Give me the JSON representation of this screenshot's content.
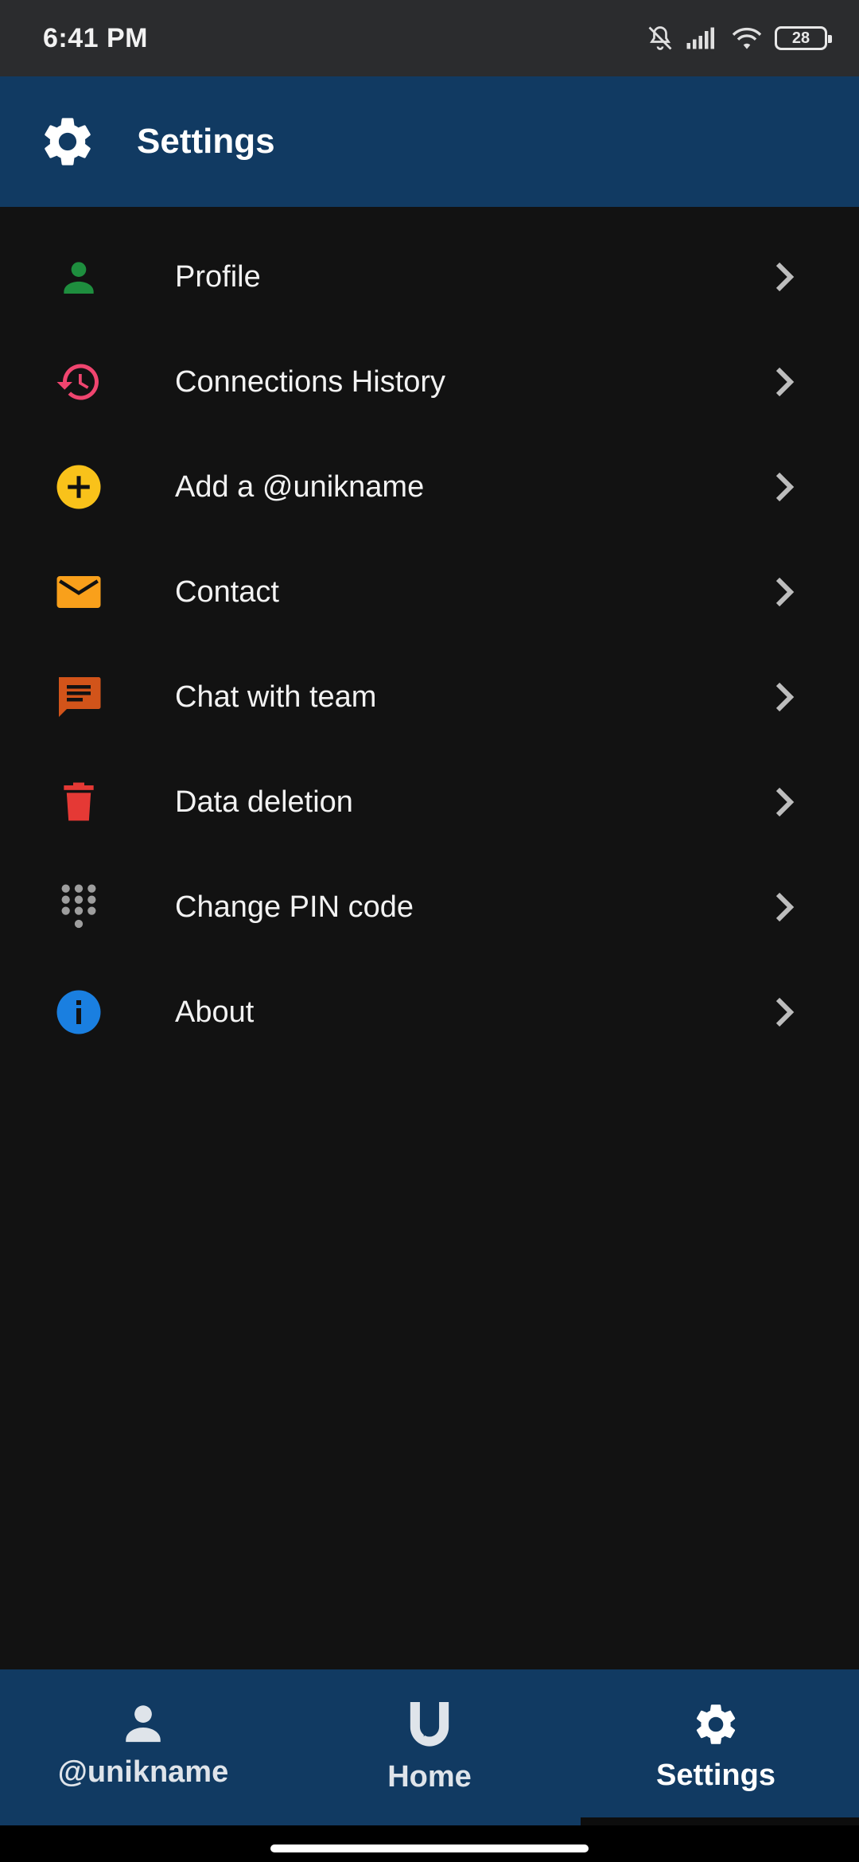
{
  "status_bar": {
    "time": "6:41 PM",
    "battery": "28"
  },
  "app_bar": {
    "title": "Settings",
    "icon": "gear-icon"
  },
  "menu": {
    "items": [
      {
        "label": "Profile",
        "icon": "person-icon",
        "color": "#1e8e3e"
      },
      {
        "label": "Connections History",
        "icon": "history-icon",
        "color": "#f0456f"
      },
      {
        "label": "Add a @unikname",
        "icon": "add-circle-icon",
        "color": "#f9c21a"
      },
      {
        "label": "Contact",
        "icon": "mail-icon",
        "color": "#f9a01b"
      },
      {
        "label": "Chat with team",
        "icon": "chat-icon",
        "color": "#d2541a"
      },
      {
        "label": "Data deletion",
        "icon": "trash-icon",
        "color": "#e53935"
      },
      {
        "label": "Change PIN code",
        "icon": "dialpad-icon",
        "color": "#9e9e9e"
      },
      {
        "label": "About",
        "icon": "info-icon",
        "color": "#1a7fe0"
      }
    ]
  },
  "bottom_nav": {
    "items": [
      {
        "label": "@unikname",
        "icon": "person-icon"
      },
      {
        "label": "Home",
        "icon": "unikname-logo-icon"
      },
      {
        "label": "Settings",
        "icon": "gear-icon"
      }
    ],
    "active": "Settings"
  },
  "colors": {
    "app_bar": "#113a62",
    "background": "#121212",
    "status_bar": "#2b2c2e"
  }
}
